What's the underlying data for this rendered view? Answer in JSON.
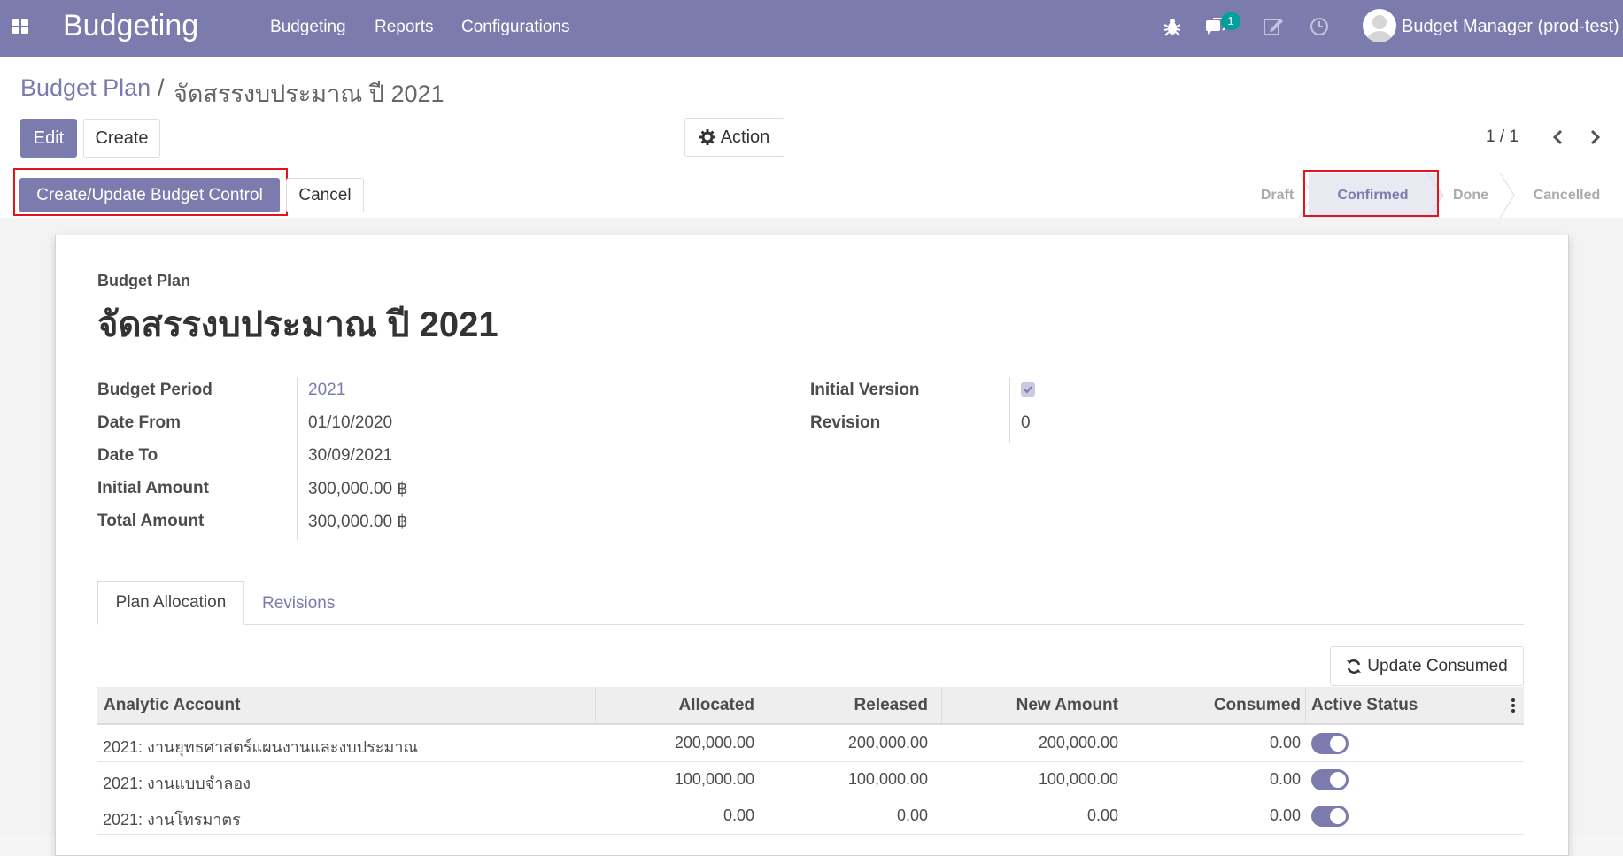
{
  "navbar": {
    "apps_icon": "apps-grid-icon",
    "brand": "Budgeting",
    "menu": [
      "Budgeting",
      "Reports",
      "Configurations"
    ],
    "messages_count": "1",
    "user_name": "Budget Manager (prod-test)",
    "color": "#7c7bad"
  },
  "breadcrumb": {
    "parent": "Budget Plan",
    "separator": "/",
    "current": "จัดสรรงบประมาณ ปี 2021"
  },
  "toolbar": {
    "edit_label": "Edit",
    "create_label": "Create",
    "action_label": "Action",
    "pager": "1 / 1"
  },
  "statusbar": {
    "create_update_label": "Create/Update Budget Control",
    "cancel_label": "Cancel",
    "stages": [
      "Draft",
      "Confirmed",
      "Done",
      "Cancelled"
    ],
    "active_stage": "Confirmed"
  },
  "form": {
    "sheet_label": "Budget Plan",
    "title": "จัดสรรงบประมาณ ปี 2021",
    "fields_left": [
      {
        "label": "Budget Period",
        "value": "2021"
      },
      {
        "label": "Date From",
        "value": "01/10/2020"
      },
      {
        "label": "Date To",
        "value": "30/09/2021"
      },
      {
        "label": "Initial Amount",
        "value": "300,000.00 ฿"
      },
      {
        "label": "Total Amount",
        "value": "300,000.00 ฿"
      }
    ],
    "fields_right": [
      {
        "label": "Initial Version",
        "value": true
      },
      {
        "label": "Revision",
        "value": "0"
      }
    ]
  },
  "tabs": {
    "active": "Plan Allocation",
    "other": "Revisions"
  },
  "update_consumed_label": "Update Consumed",
  "table": {
    "columns": [
      "Analytic Account",
      "Allocated",
      "Released",
      "New Amount",
      "Consumed",
      "Active Status"
    ],
    "rows": [
      {
        "account": "2021: งานยุทธศาสตร์แผนงานและงบประมาณ",
        "allocated": "200,000.00",
        "released": "200,000.00",
        "new_amount": "200,000.00",
        "consumed": "0.00",
        "active": true
      },
      {
        "account": "2021: งานแบบจำลอง",
        "allocated": "100,000.00",
        "released": "100,000.00",
        "new_amount": "100,000.00",
        "consumed": "0.00",
        "active": true
      },
      {
        "account": "2021: งานโทรมาตร",
        "allocated": "0.00",
        "released": "0.00",
        "new_amount": "0.00",
        "consumed": "0.00",
        "active": true
      }
    ]
  }
}
